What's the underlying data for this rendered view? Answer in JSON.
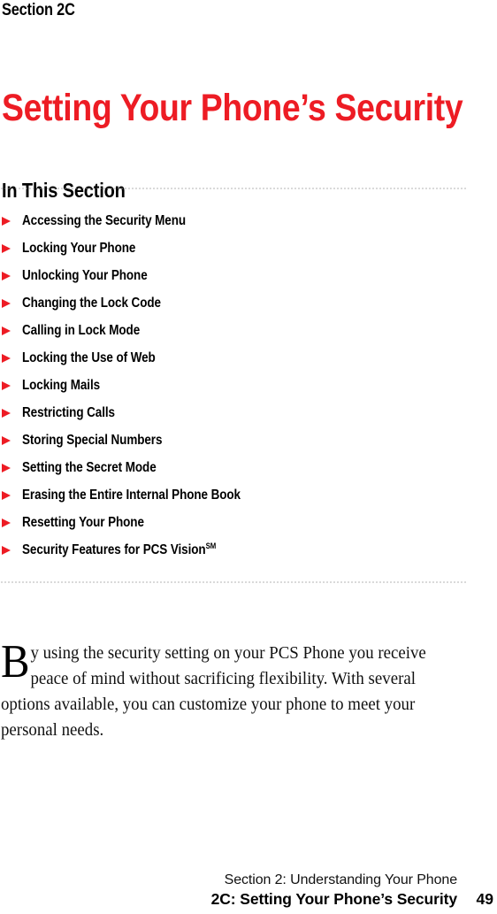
{
  "eyebrow": "Section 2C",
  "chapter_title": "Setting Your Phone’s Security",
  "section": {
    "heading": "In This Section",
    "items": [
      {
        "label": "Accessing the Security Menu"
      },
      {
        "label": "Locking Your Phone"
      },
      {
        "label": "Unlocking Your Phone"
      },
      {
        "label": "Changing the Lock Code"
      },
      {
        "label": "Calling in Lock Mode"
      },
      {
        "label": "Locking the Use of Web"
      },
      {
        "label": "Locking Mails"
      },
      {
        "label": "Restricting Calls"
      },
      {
        "label": "Storing Special Numbers"
      },
      {
        "label": "Setting the Secret Mode"
      },
      {
        "label": "Erasing the Entire Internal Phone Book"
      },
      {
        "label": "Resetting Your Phone"
      },
      {
        "label": "Security Features for PCS Vision",
        "superscript": "SM"
      }
    ]
  },
  "body": {
    "dropcap": "B",
    "text": "y using the security setting on your PCS Phone you receive peace of mind without sacrificing flexibility. With several options available, you can customize your phone to meet your personal needs."
  },
  "footer": {
    "line1": "Section 2: Understanding Your Phone",
    "line2": "2C: Setting Your Phone’s Security",
    "page_number": "49"
  },
  "colors": {
    "accent_red": "#ED1C24",
    "text_black": "#000000",
    "rule_gray": "#9a9a9a"
  }
}
